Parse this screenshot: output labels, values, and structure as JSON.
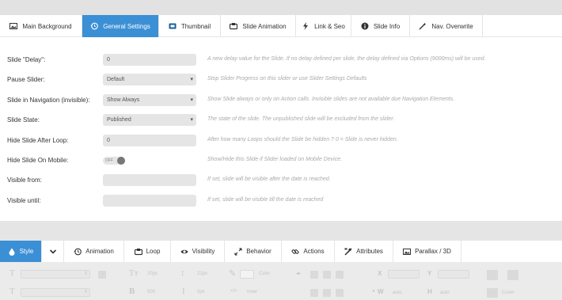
{
  "tabs": [
    {
      "label": "Main Background",
      "icon": "image-icon"
    },
    {
      "label": "General Settings",
      "icon": "history-icon"
    },
    {
      "label": "Thumbnail",
      "icon": "thumbnail-icon"
    },
    {
      "label": "Slide Animation",
      "icon": "slideshow-icon"
    },
    {
      "label": "Link & Seo",
      "icon": "bolt-icon"
    },
    {
      "label": "Slide Info",
      "icon": "info-icon"
    },
    {
      "label": "Nav. Overwrite",
      "icon": "wand-icon"
    }
  ],
  "active_tab": "General Settings",
  "settings": {
    "delay": {
      "label": "Slide \"Delay\":",
      "value": "0",
      "desc": "A new delay value for the Slide. If no delay defined per slide, the delay defined via Options (9000ms) will be used."
    },
    "pause": {
      "label": "Pause Slider:",
      "value": "Default",
      "desc": "Stop Slider Progress on this slider or use Slider Settings Defaults"
    },
    "nav": {
      "label": "Slide in Navigation (invisible):",
      "value": "Show Always",
      "desc": "Show Slide always or only on Action calls. Invisible slides are not available due Navigation Elements."
    },
    "state": {
      "label": "Slide State:",
      "value": "Published",
      "desc": "The state of the slide. The unpublished slide will be excluded from the slider."
    },
    "hide_loop": {
      "label": "Hide Slide After Loop:",
      "value": "0",
      "desc": "After how many Loops should the Slide be hidden ? 0 = Slide is never hidden."
    },
    "hide_mobile": {
      "label": "Hide Slide On Mobile:",
      "value": "OFF",
      "desc": "Show/Hide this Slide if Slider loaded on Mobile Device."
    },
    "visible_from": {
      "label": "Visible from:",
      "value": "",
      "desc": "If set, slide will be visible after the date is reached."
    },
    "visible_until": {
      "label": "Visible until:",
      "value": "",
      "desc": "If set, slide will be visible till the date is reached"
    }
  },
  "layer_tabs": [
    {
      "label": "Style",
      "icon": "drop-icon"
    },
    {
      "label": "",
      "icon": "chevron-down-icon"
    },
    {
      "label": "Animation",
      "icon": "history-icon"
    },
    {
      "label": "Loop",
      "icon": "loop-icon"
    },
    {
      "label": "Visibility",
      "icon": "eye-icon"
    },
    {
      "label": "Behavior",
      "icon": "arrows-icon"
    },
    {
      "label": "Actions",
      "icon": "link-icon"
    },
    {
      "label": "Attributes",
      "icon": "tools-icon"
    },
    {
      "label": "Parallax / 3D",
      "icon": "image-icon"
    }
  ],
  "toolbar": {
    "font_size": "20px",
    "line_height": "22px",
    "color": "Color",
    "x": "X",
    "y": "Y",
    "weight": "500",
    "size": "0px",
    "w": "W",
    "h": "H",
    "auto_w": "auto",
    "auto_h": "auto",
    "cover": "Cover",
    "wrap": "nowr"
  },
  "colors": {
    "accent": "#3b8fd5",
    "panel": "#ffffff",
    "bg": "#e5e5e5",
    "muted_text": "#aaaaaa"
  }
}
